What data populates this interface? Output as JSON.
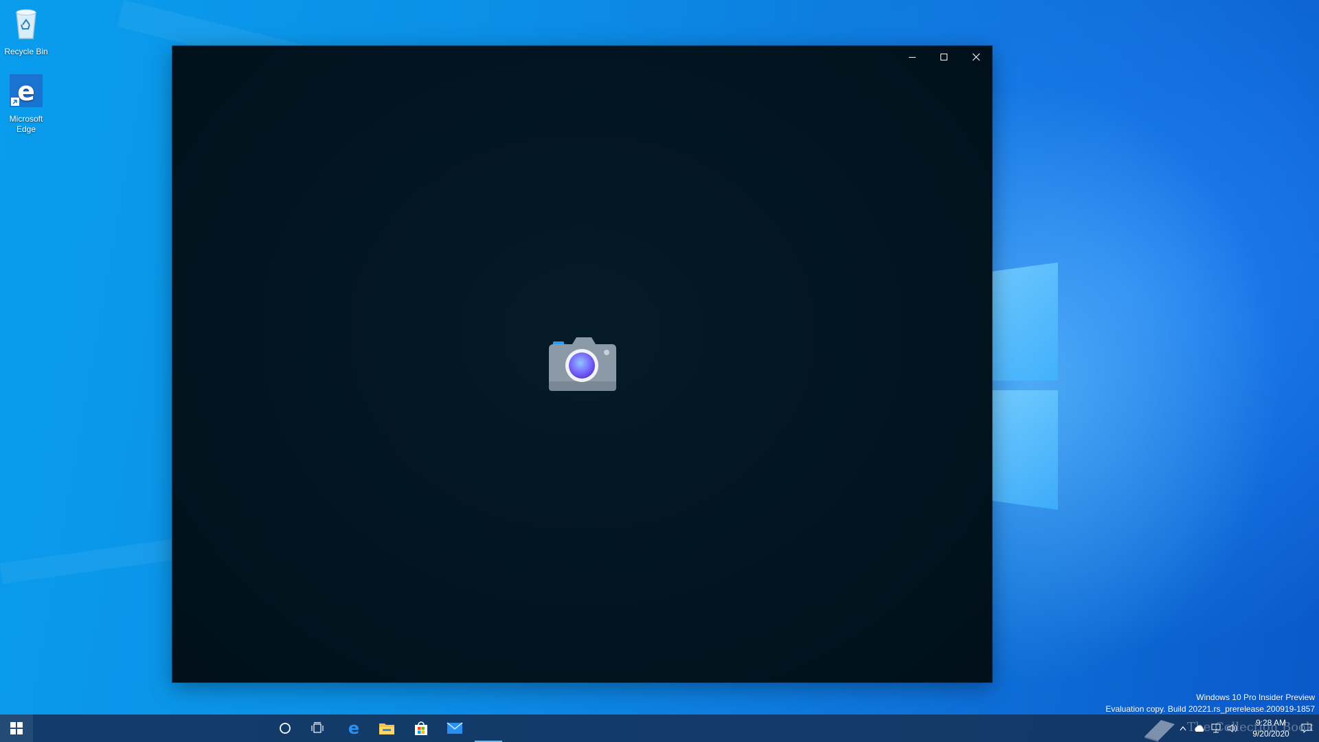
{
  "desktop": {
    "icons": [
      {
        "label": "Recycle Bin",
        "icon": "recycle-bin-icon"
      },
      {
        "label": "Microsoft Edge",
        "icon": "edge-icon"
      }
    ],
    "watermark_line1": "Windows 10 Pro Insider Preview",
    "watermark_line2": "Evaluation copy. Build 20221.rs_prerelease.200919-1857"
  },
  "camera_window": {
    "app": "Camera",
    "caption_buttons": [
      "minimize",
      "maximize",
      "close"
    ],
    "splash_icon": "camera-icon",
    "background_color": "#021722"
  },
  "taskbar": {
    "start_icon": "windows-logo-icon",
    "pinned": [
      {
        "name": "Cortana",
        "icon": "cortana-circle-icon"
      },
      {
        "name": "Task View",
        "icon": "task-view-icon"
      },
      {
        "name": "Microsoft Edge",
        "icon": "edge-icon"
      },
      {
        "name": "File Explorer",
        "icon": "folder-icon"
      },
      {
        "name": "Microsoft Store",
        "icon": "store-bag-icon"
      },
      {
        "name": "Mail",
        "icon": "mail-icon"
      }
    ],
    "tray_overlay_text": "The Collection Book",
    "clock_time": "9:28 AM",
    "clock_date": "9/20/2020",
    "accent": "#76b9ed"
  }
}
